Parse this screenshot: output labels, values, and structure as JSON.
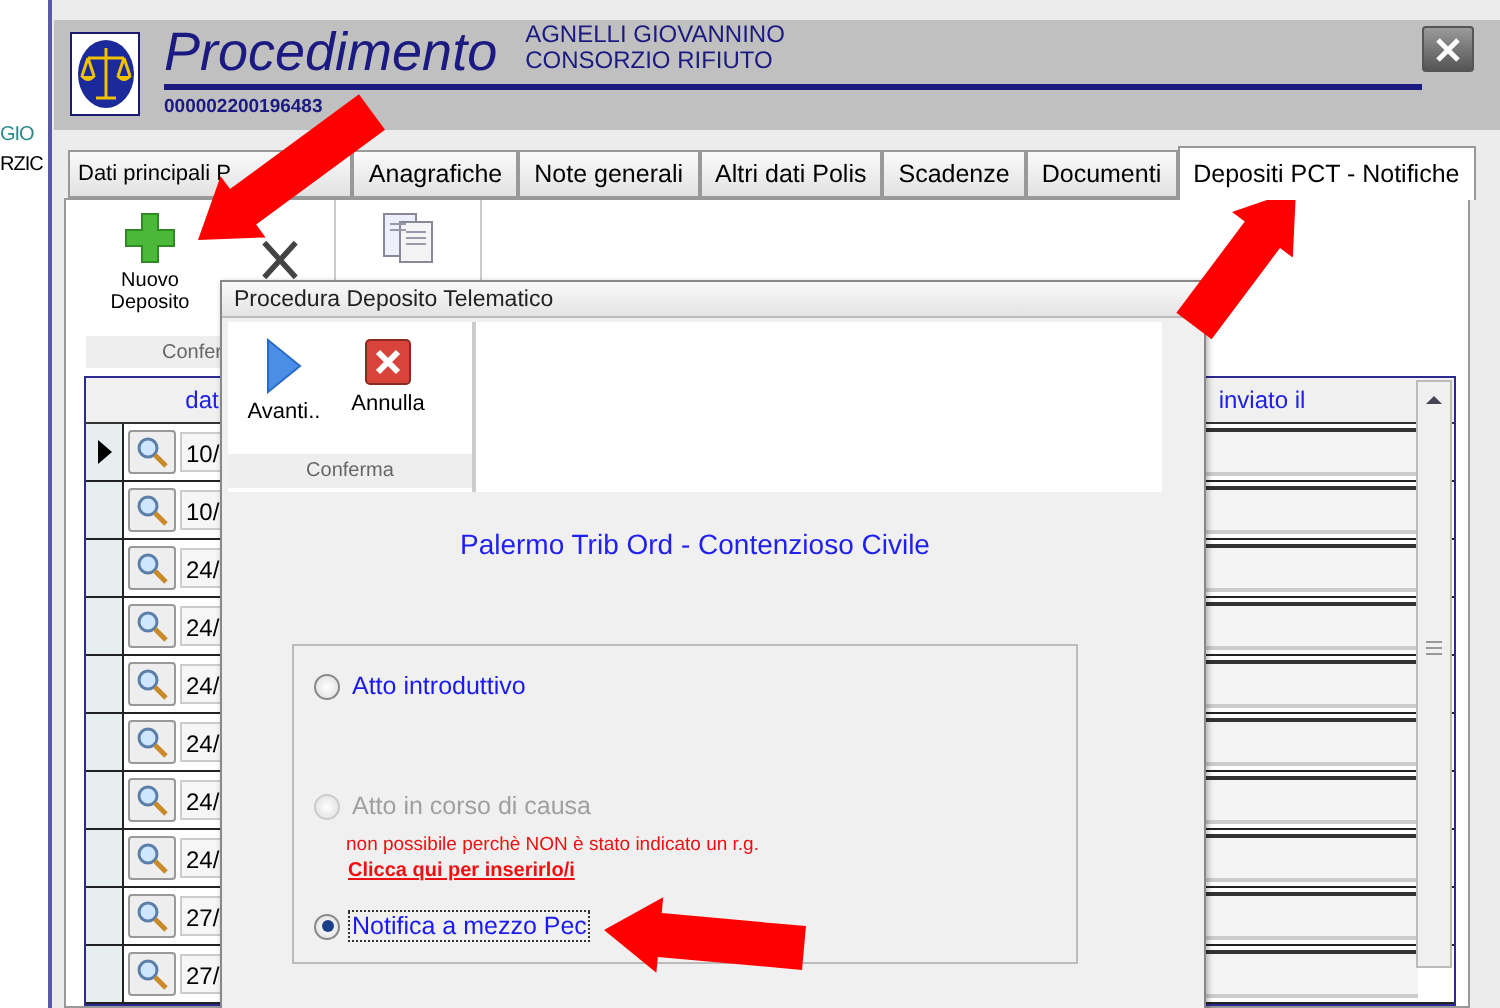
{
  "left_panel": {
    "texts": [
      "GIO",
      "RZIC"
    ]
  },
  "header": {
    "title": "Procedimento",
    "names": [
      "AGNELLI GIOVANNINO",
      "CONSORZIO RIFIUTO"
    ],
    "number": "000002200196483"
  },
  "tabs": [
    {
      "label": "Dati principali P",
      "selected": false
    },
    {
      "label": "Anagrafiche",
      "selected": false
    },
    {
      "label": "Note generali",
      "selected": false
    },
    {
      "label": "Altri dati Polis",
      "selected": false
    },
    {
      "label": "Scadenze",
      "selected": false
    },
    {
      "label": "Documenti",
      "selected": false
    },
    {
      "label": "Depositi PCT - Notifiche",
      "selected": true
    }
  ],
  "toolbar": {
    "buttons": [
      {
        "kind": "add",
        "label": "Nuovo Deposito"
      },
      {
        "kind": "delete"
      },
      {
        "kind": "document"
      }
    ],
    "group_label": "Confer"
  },
  "table": {
    "columns": [
      "dat",
      "inviato il"
    ],
    "rows": [
      {
        "current": true,
        "date": "10/"
      },
      {
        "current": false,
        "date": "10/"
      },
      {
        "current": false,
        "date": "24/"
      },
      {
        "current": false,
        "date": "24/"
      },
      {
        "current": false,
        "date": "24/"
      },
      {
        "current": false,
        "date": "24/"
      },
      {
        "current": false,
        "date": "24/"
      },
      {
        "current": false,
        "date": "24/"
      },
      {
        "current": false,
        "date": "27/"
      },
      {
        "current": false,
        "date": "27/"
      }
    ]
  },
  "dialog": {
    "title": "Procedura Deposito Telematico",
    "buttons": [
      {
        "kind": "next",
        "label": "Avanti.."
      },
      {
        "kind": "cancel",
        "label": "Annulla"
      }
    ],
    "group_label": "Conferma",
    "court": "Palermo Trib Ord - Contenzioso Civile",
    "options": [
      {
        "label": "Atto introduttivo",
        "selected": false,
        "disabled": false
      },
      {
        "label": "Atto in corso di causa",
        "selected": false,
        "disabled": true,
        "note": "non possibile perchè NON è stato indicato un r.g.",
        "link": "Clicca qui per inserirlo/i"
      },
      {
        "label": "Notifica a mezzo Pec",
        "selected": true,
        "disabled": false
      }
    ]
  }
}
